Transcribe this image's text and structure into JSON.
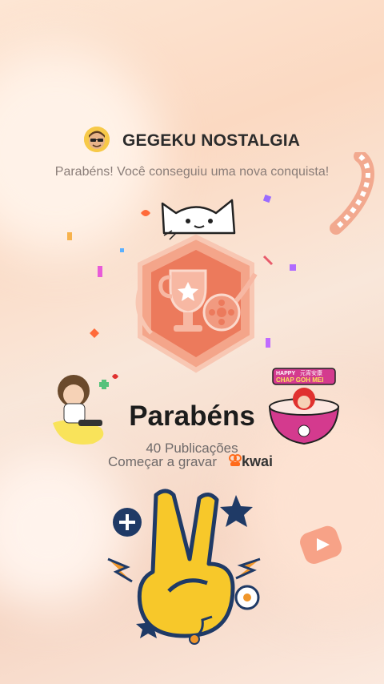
{
  "header": {
    "username": "GEGEKU NOSTALGIA",
    "avatar_icon": "sunglasses-avatar"
  },
  "message": "Parabéns! Você conseguiu uma nova conquista!",
  "achievement": {
    "badge_icon": "trophy-film-badge",
    "title": "Parabéns",
    "count_text": "40 Publicações"
  },
  "cta": {
    "label": "Começar a gravar",
    "brand": "kwai"
  },
  "stickers": [
    "cat-sticker",
    "boy-sticker",
    "chap-goh-mei-bowl-sticker",
    "peace-hand-sticker"
  ],
  "bowl_sticker_text": {
    "line1": "HAPPY",
    "line2": "元宵安康",
    "line3": "CHAP GOH MEI"
  },
  "colors": {
    "accent": "#ff6a1a",
    "badge": "#ec7a5c",
    "background": "#fbe4d3"
  }
}
